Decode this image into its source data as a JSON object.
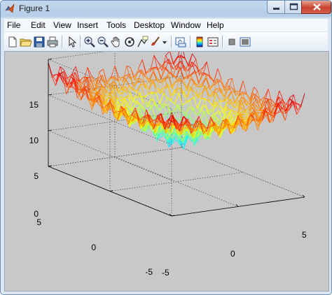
{
  "window": {
    "title": "Figure 1"
  },
  "menu": [
    "File",
    "Edit",
    "View",
    "Insert",
    "Tools",
    "Desktop",
    "Window",
    "Help"
  ],
  "toolbar": [
    {
      "name": "new-figure-icon"
    },
    {
      "name": "open-file-icon"
    },
    {
      "name": "save-icon"
    },
    {
      "name": "print-icon"
    },
    {
      "name": "edit-plot-arrow-icon"
    },
    {
      "name": "zoom-in-icon"
    },
    {
      "name": "zoom-out-icon"
    },
    {
      "name": "pan-hand-icon"
    },
    {
      "name": "rotate-3d-icon"
    },
    {
      "name": "data-cursor-icon"
    },
    {
      "name": "brush-icon"
    },
    {
      "name": "brush-dropdown-icon"
    },
    {
      "name": "link-plot-icon"
    },
    {
      "name": "insert-colorbar-icon"
    },
    {
      "name": "insert-legend-icon"
    },
    {
      "name": "hide-plot-tools-icon"
    },
    {
      "name": "show-plot-tools-icon"
    }
  ],
  "axes": {
    "z_ticks": [
      "0",
      "5",
      "10",
      "15"
    ],
    "y_ticks": [
      "5",
      "0",
      "-5"
    ],
    "x_ticks": [
      "-5",
      "0",
      "5"
    ]
  },
  "chart_data": {
    "type": "surface-mesh",
    "x_range": [
      -5,
      5
    ],
    "y_range": [
      -5,
      5
    ],
    "z_range": [
      0,
      15
    ],
    "z_ticks": [
      0,
      5,
      10,
      15
    ],
    "x_ticks": [
      -5,
      0,
      5
    ],
    "y_ticks": [
      -5,
      0,
      5
    ],
    "colormap": "jet",
    "grid": true,
    "box": true
  }
}
